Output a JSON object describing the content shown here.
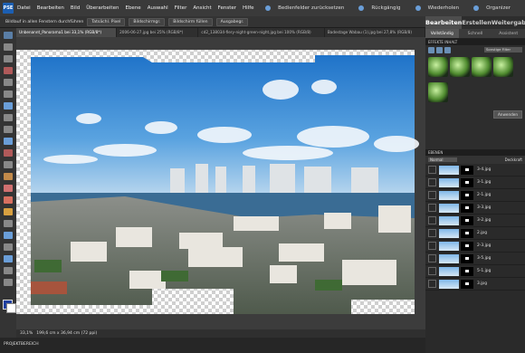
{
  "menu": {
    "logo": "PSE",
    "items": [
      "Datei",
      "Bearbeiten",
      "Bild",
      "Überarbeiten",
      "Ebene",
      "Auswahl",
      "Filter",
      "Ansicht",
      "Fenster",
      "Hilfe"
    ],
    "right": [
      "Bedienfelder zurücksetzen",
      "Rückgängig",
      "Wiederholen",
      "Organizer"
    ]
  },
  "options": {
    "checkbox_label": "Bildlauf in allen Fenstern durchführen",
    "buttons": [
      "Tatsächl. Pixel",
      "Bildschirmgr.",
      "Bildschirm füllen",
      "Ausgabegr."
    ]
  },
  "doc_tabs": [
    "Unbenannt_Panorama1 bei 33,1% (RGB/8*)",
    "2006-06-27.jpg bei 25% (RGB/8*)",
    "cd2_138034-fiery-night-green-night.jpg bei 100% (RGB/8)",
    "Badestage Wabau (1).jpg bei 27,8% (RGB/8)"
  ],
  "status": {
    "zoom": "33,1%",
    "size": "199,6 cm x 36,94 cm (72 ppi)"
  },
  "project_bin": "PROJEKTBEREICH",
  "right_panel": {
    "modes": [
      "Bearbeiten",
      "Erstellen",
      "Weitergabe"
    ],
    "submodes": [
      "Vollständig",
      "Schnell",
      "Assistent"
    ],
    "effects_header": "EFFEKTE  INHALT",
    "filter_dropdown": "Sonstige Filter",
    "apply_button": "Anwenden",
    "layers_header": "EBENEN",
    "blend_mode": "Normal",
    "opacity": "Deckkraft",
    "layers": [
      "3-4.jpg",
      "3-1.jpg",
      "2-1.jpg",
      "3-3.jpg",
      "3-2.jpg",
      "2.jpg",
      "2-3.jpg",
      "3-5.jpg",
      "5-1.jpg",
      "3.jpg"
    ]
  },
  "colors": {
    "accent": "#1c5fb2",
    "panel_bg": "#2d2d2d",
    "canvas_bg": "#3c3c3c"
  }
}
